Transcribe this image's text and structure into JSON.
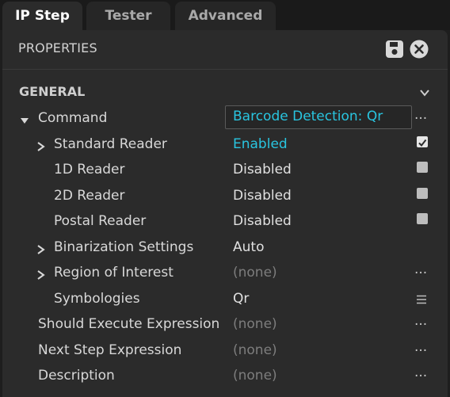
{
  "tabs": [
    {
      "label": "IP Step",
      "active": true
    },
    {
      "label": "Tester",
      "active": false
    },
    {
      "label": "Advanced",
      "active": false
    }
  ],
  "panel": {
    "title": "PROPERTIES",
    "icons": [
      "save-icon",
      "close-circle-icon"
    ]
  },
  "section": {
    "label": "GENERAL",
    "icon": "chevron-down-icon"
  },
  "command": {
    "label": "Command",
    "value": "Barcode Detection: Qr",
    "more": "..."
  },
  "rows": [
    {
      "label": "Standard Reader",
      "value": "Enabled",
      "checked": true
    },
    {
      "label": "1D Reader",
      "value": "Disabled",
      "checked": false
    },
    {
      "label": "2D Reader",
      "value": "Disabled",
      "checked": false
    },
    {
      "label": "Postal Reader",
      "value": "Disabled",
      "checked": false
    },
    {
      "label": "Binarization Settings",
      "value": "Auto"
    },
    {
      "label": "Region of Interest",
      "value": "(none)",
      "more": "..."
    },
    {
      "label": "Symbologies",
      "value": "Qr",
      "icon": "list-icon"
    },
    {
      "label": "Should Execute Expression",
      "value": "(none)",
      "more": "..."
    },
    {
      "label": "Next Step Expression",
      "value": "(none)",
      "more": "..."
    },
    {
      "label": "Description",
      "value": "(none)",
      "more": "..."
    }
  ],
  "colors": {
    "accent": "#29c5e0",
    "panel": "#2b2b2b",
    "background": "#1e1e1e"
  }
}
